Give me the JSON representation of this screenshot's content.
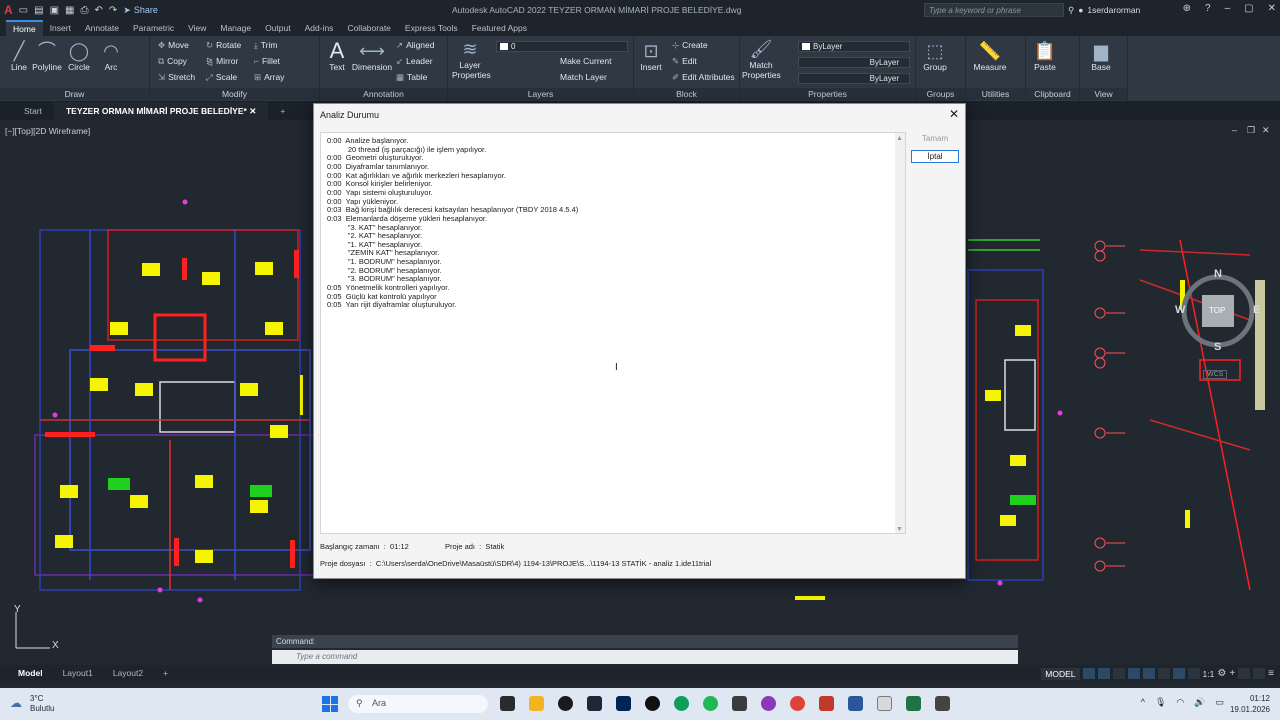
{
  "titlebar": {
    "share_label": "Share",
    "window_title": "Autodesk AutoCAD 2022   TEYZER ORMAN MİMARİ PROJE BELEDİYE.dwg",
    "search_placeholder": "Type a keyword or phrase",
    "user": "1serdarorman"
  },
  "menu_tabs": [
    "Home",
    "Insert",
    "Annotate",
    "Parametric",
    "View",
    "Manage",
    "Output",
    "Add-ins",
    "Collaborate",
    "Express Tools",
    "Featured Apps"
  ],
  "ribbon": {
    "draw": {
      "title": "Draw",
      "line": "Line",
      "polyline": "Polyline",
      "circle": "Circle",
      "arc": "Arc"
    },
    "modify": {
      "title": "Modify",
      "move": "Move",
      "rotate": "Rotate",
      "trim": "Trim",
      "copy": "Copy",
      "mirror": "Mirror",
      "fillet": "Fillet",
      "stretch": "Stretch",
      "scale": "Scale",
      "array": "Array"
    },
    "annotation": {
      "title": "Annotation",
      "text": "Text",
      "dimension": "Dimension",
      "aligned": "Aligned",
      "leader": "Leader",
      "table": "Table"
    },
    "layers": {
      "title": "Layers",
      "layer_properties_1": "Layer",
      "layer_properties_2": "Properties",
      "current_layer": "0",
      "make_current": "Make Current",
      "match_layer": "Match Layer"
    },
    "block": {
      "title": "Block",
      "insert": "Insert",
      "create": "Create",
      "edit": "Edit",
      "edit_attributes": "Edit Attributes"
    },
    "properties": {
      "title": "Properties",
      "match_1": "Match",
      "match_2": "Properties",
      "color": "ByLayer",
      "linetype": "ByLayer",
      "lineweight": "ByLayer"
    },
    "groups": {
      "title": "Groups",
      "group": "Group"
    },
    "utilities": {
      "title": "Utilities",
      "measure": "Measure"
    },
    "clipboard": {
      "title": "Clipboard",
      "paste": "Paste"
    },
    "view": {
      "title": "View",
      "base": "Base"
    }
  },
  "doc_tabs": {
    "start": "Start",
    "active": "TEYZER ORMAN MİMARİ PROJE BELEDİYE*"
  },
  "viewport": {
    "label": "[−][Top][2D Wireframe]",
    "compass": {
      "n": "N",
      "s": "S",
      "e": "E",
      "w": "W",
      "top": "TOP",
      "wcs": "WCS"
    },
    "ucs_y": "Y",
    "ucs_x": "X"
  },
  "command": {
    "history": "Command:",
    "placeholder": "Type a command"
  },
  "layout_tabs": [
    "Model",
    "Layout1",
    "Layout2"
  ],
  "status": {
    "model": "MODEL",
    "scale": "1:1"
  },
  "taskbar": {
    "temp": "3°C",
    "weather": "Bulutlu",
    "search": "Ara",
    "time": "01:12",
    "date": "19.01.2026"
  },
  "dialog": {
    "title": "Analiz Durumu",
    "ok": "Tamam",
    "cancel": "İptal",
    "log": [
      "0:00  Analize başlanıyor.",
      "          20 thread (iş parçacığı) ile işlem yapılıyor.",
      "0:00  Geometri oluşturuluyor.",
      "0:00  Diyaframlar tanımlanıyor.",
      "0:00  Kat ağırlıkları ve ağırlık merkezleri hesaplanıyor.",
      "0:00  Konsol kirişler belirleniyor.",
      "0:00  Yapı sistemi oluşturuluyor.",
      "0:00  Yapı yükleniyor.",
      "0:03  Bağ kirişi bağlılık derecesi katsayıları hesaplanıyor (TBDY 2018 4.5.4)",
      "0:03  Elemanlarda döşeme yükleri hesaplanıyor.",
      "          \"3. KAT\" hesaplanıyor.",
      "          \"2. KAT\" hesaplanıyor.",
      "          \"1. KAT\" hesaplanıyor.",
      "          \"ZEMİN KAT\" hesaplanıyor.",
      "          \"1. BODRUM\" hesaplanıyor.",
      "          \"2. BODRUM\" hesaplanıyor.",
      "          \"3. BODRUM\" hesaplanıyor.",
      "0:05  Yönetmelik kontrolleri yapılıyor.",
      "0:05  Güçlü kat kontrolü yapılıyor",
      "0:05  Yarı rijit diyaframlar oluşturuluyor."
    ],
    "start_label": "Başlangıç zamanı  :  01:12",
    "project_name": "Proje adı  :  Statik",
    "project_file": "Proje dosyası  :  C:\\Users\\serda\\OneDrive\\Masaüstü\\SDR\\4) 1194-13\\PROJE\\S...\\1194-13 STATİK - analiz 1.ide11trial"
  }
}
